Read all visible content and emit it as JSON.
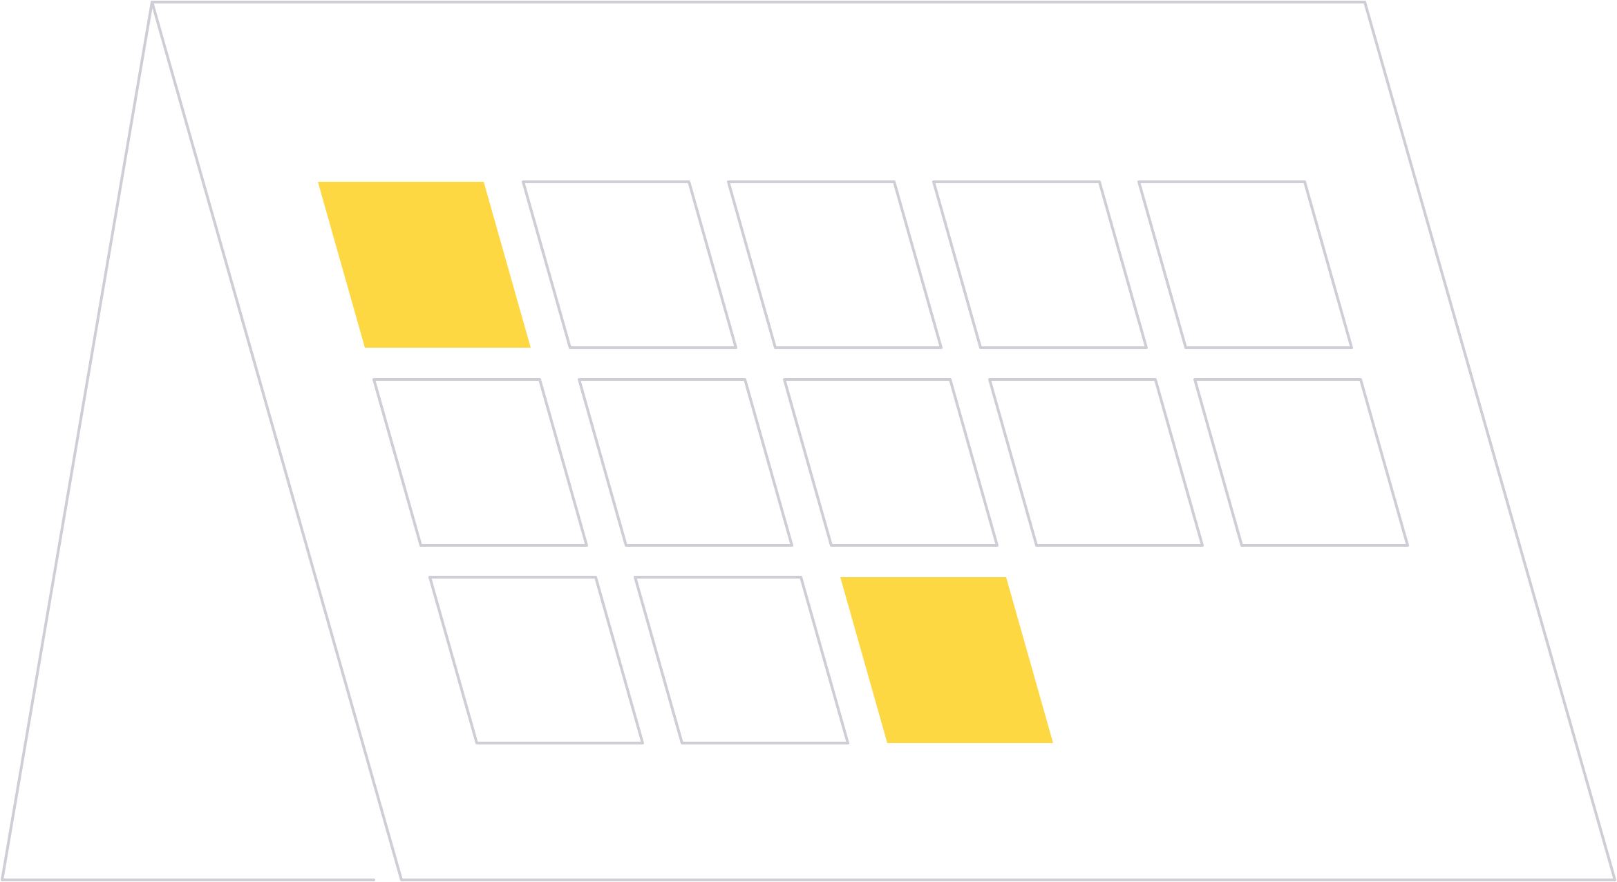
{
  "illustration": {
    "type": "calendar-icon",
    "colors": {
      "line": "#cfcdd6",
      "highlight": "#fed843",
      "background": "#ffffff"
    },
    "grid": {
      "rows": [
        {
          "cells": [
            true,
            false,
            false,
            false,
            false
          ]
        },
        {
          "cells": [
            false,
            false,
            false,
            false,
            false
          ]
        },
        {
          "cells": [
            false,
            false,
            true
          ]
        }
      ]
    }
  }
}
